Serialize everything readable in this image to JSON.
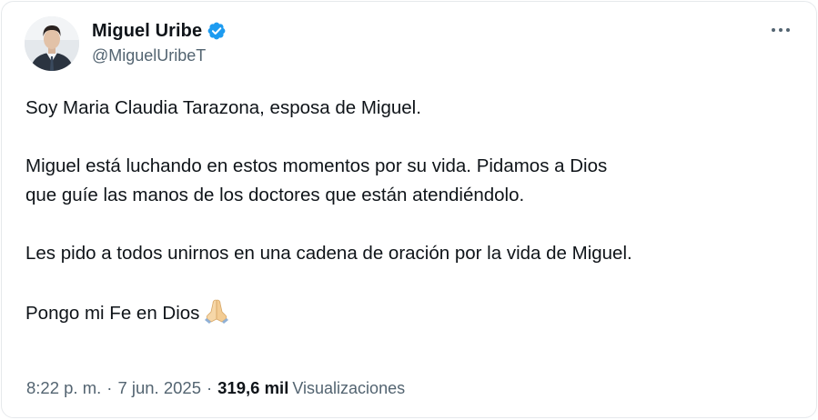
{
  "author": {
    "display_name": "Miguel Uribe",
    "handle": "@MiguelUribeT",
    "verified": true,
    "verified_color": "#1d9bf0"
  },
  "more_icon": "more-horizontal-icon",
  "tweet": {
    "paragraphs": [
      "Soy Maria Claudia Tarazona, esposa de Miguel.",
      "Miguel está luchando en estos momentos por su vida. Pidamos a Dios\nque guíe las manos de los doctores que están atendiéndolo.",
      "Les pido a todos unirnos en una cadena de oración por la vida de Miguel.",
      "Pongo mi Fe en Dios"
    ],
    "emoji": "folded-hands-emoji"
  },
  "meta": {
    "time": "8:22 p. m.",
    "separator": "·",
    "date": "7 jun. 2025",
    "views_count": "319,6 mil",
    "views_label": "Visualizaciones"
  },
  "colors": {
    "text": "#0f1419",
    "secondary": "#536471",
    "border": "#e6e9ec"
  }
}
